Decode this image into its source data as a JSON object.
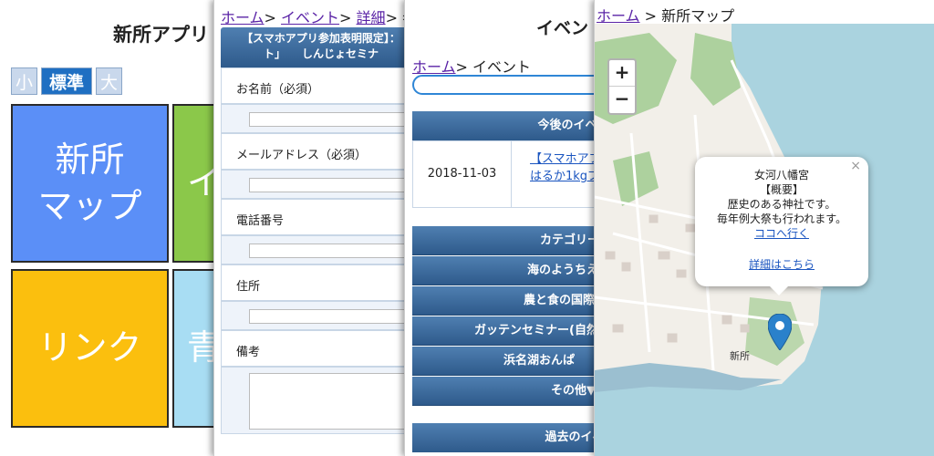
{
  "panel1": {
    "title": "新所アプリ",
    "size_buttons": {
      "small": "小",
      "normal": "標準",
      "large": "大"
    },
    "tiles": [
      {
        "label": "新所\nマップ",
        "color": "#5b8ff7"
      },
      {
        "label": "イ",
        "color": "#8bc84a"
      },
      {
        "label": "リンク",
        "color": "#fbbf0e"
      },
      {
        "label": "青",
        "color": "#a8ddf3"
      }
    ]
  },
  "panel2": {
    "breadcrumb": {
      "home": "ホーム",
      "sep": ">",
      "event": "イベント",
      "detail": "詳細",
      "current": "参"
    },
    "form_header": "【スマホアプリ参加表明限定】：\nト」　　しんじょセミナ",
    "fields": [
      "お名前（必須）",
      "メールアドレス（必須）",
      "電話番号",
      "住所",
      "備考"
    ]
  },
  "panel3": {
    "title": "イベン",
    "breadcrumb": {
      "home": "ホーム",
      "current": "> イベント"
    },
    "upcoming_header": "今後のイベ",
    "event": {
      "date": "2018-11-03",
      "link_line1": "【スマホアプ",
      "link_line2": "はるか1kgプ"
    },
    "categories": [
      "カテゴリー",
      "海のようちえ",
      "農と食の国際",
      "ガッテンセミナー(自然",
      "浜名湖おんぱ",
      "その他▼"
    ],
    "past_header": "過去のイベ"
  },
  "panel4": {
    "breadcrumb": {
      "home": "ホーム",
      "current": " > 新所マップ"
    },
    "zoom": {
      "in": "+",
      "out": "−"
    },
    "popup": {
      "name": "女河八幡宮",
      "summary_label": "【概要】",
      "desc1": "歴史のある神社です。",
      "desc2": "毎年例大祭も行われます。",
      "go_link": "ココへ行く",
      "detail_link": "詳細はこちら",
      "close": "×"
    },
    "town_label": "新所",
    "colors": {
      "water": "#aad3df",
      "land": "#f2efe9",
      "park": "#add19e",
      "pin": "#2a81cb"
    }
  }
}
